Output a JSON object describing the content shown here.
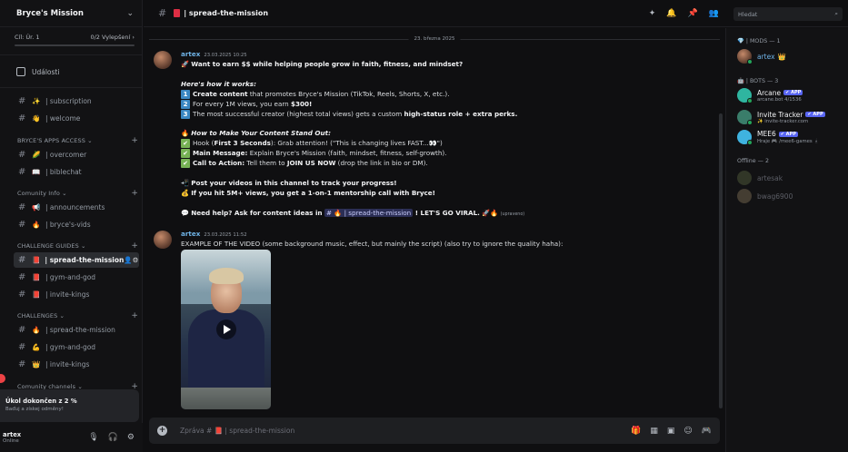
{
  "server": {
    "name": "Bryce's Mission"
  },
  "goal": {
    "label": "Cíl: Úr. 1",
    "progress_text": "0/2 Vylepšení",
    "progress": 0
  },
  "sidebar": {
    "events_label": "Události",
    "top_channels": [
      {
        "emoji": "✨",
        "name": "| subscription"
      },
      {
        "emoji": "👋",
        "name": "| welcome"
      }
    ],
    "categories": [
      {
        "title": "BRYCE'S APPS ACCESS",
        "channels": [
          {
            "emoji": "🌽",
            "name": "| overcomer"
          },
          {
            "emoji": "📖",
            "name": "| biblechat"
          }
        ]
      },
      {
        "title": "Comunity Info",
        "channels": [
          {
            "emoji": "📢",
            "name": "| announcements"
          },
          {
            "emoji": "🔥",
            "name": "| bryce's-vids"
          }
        ]
      },
      {
        "title": "CHALLENGE GUIDES",
        "channels": [
          {
            "emoji": "📕",
            "name": "| spread-the-mission",
            "active": true
          },
          {
            "emoji": "📕",
            "name": "| gym-and-god"
          },
          {
            "emoji": "📕",
            "name": "| invite-kings"
          }
        ]
      },
      {
        "title": "CHALLENGES",
        "channels": [
          {
            "emoji": "🔥",
            "name": "| spread-the-mission"
          },
          {
            "emoji": "💪",
            "name": "| gym-and-god"
          },
          {
            "emoji": "👑",
            "name": "| invite-kings"
          }
        ]
      },
      {
        "title": "Comunity channels",
        "channels": []
      }
    ],
    "task_popup": {
      "title": "Úkol dokončen z 2 %",
      "subtitle": "Baďuj a získej odměny!"
    },
    "user": {
      "name": "artex",
      "status": "Online"
    }
  },
  "header": {
    "channel": "| spread-the-mission",
    "search_placeholder": "Hledat"
  },
  "messages": {
    "date": "23. března 2025",
    "m1": {
      "author": "artex",
      "timestamp": "23.03.2025 10:25",
      "l1": "Want to earn $$ while helping people grow in faith, fitness, and mindset?",
      "l2": "Here's how it works:",
      "l3a": "Create content",
      "l3b": " that promotes Bryce's Mission (TikTok, Reels, Shorts, X, etc.).",
      "l4a": "For every 1M views, you earn ",
      "l4b": "$300!",
      "l5a": "The most successful creator (highest total views) gets a custom ",
      "l5b": "high-status role + extra perks.",
      "l6": "How to Make Your Content Stand Out:",
      "l7a": "Hook (",
      "l7b": "First 3 Seconds",
      "l7c": "): Grab attention! (\"This is changing lives FAST...👀\")",
      "l8a": "Main Message:",
      "l8b": " Explain Bryce's Mission (faith, mindset, fitness, self-growth).",
      "l9a": "Call to Action:",
      "l9b": " Tell them to ",
      "l9c": "JOIN US NOW",
      "l9d": " (drop the link in bio or DM).",
      "l10": "Post your videos in this channel to track your progress!",
      "l11": "If you hit 5M+ views, you get a 1-on-1 mentorship call with Bryce!",
      "l12a": "Need help? Ask for content ideas in ",
      "l12m": "# 🔥 | spread-the-mission",
      "l12b": " ! LET'S GO VIRAL. 🚀🔥",
      "l12e": "(upraveno)"
    },
    "m2": {
      "author": "artex",
      "timestamp": "23.03.2025 11:52",
      "text": "EXAMPLE OF THE VIDEO (some background music, effect, but mainly the script) (also try to ignore the quality haha):"
    }
  },
  "composer": {
    "placeholder": "Zpráva # 📕 | spread-the-mission"
  },
  "members": {
    "mods_title": "| MODS — 1",
    "mod": {
      "name": "artex",
      "badge": "👑"
    },
    "bots_title": "| BOTS — 3",
    "bots": [
      {
        "name": "Arcane",
        "tag": "✔ APP",
        "sub": "arcane.bot 4/1536"
      },
      {
        "name": "Invite Tracker",
        "tag": "✔ APP",
        "sub": "✨ invite-tracker.com"
      },
      {
        "name": "MEE6",
        "tag": "✔ APP",
        "sub": "Hraje 🎮 /mee6-games 🛓"
      }
    ],
    "offline_title": "Offline — 2",
    "offline": [
      {
        "name": "artesak"
      },
      {
        "name": "bwag6900"
      }
    ]
  },
  "colors": {
    "accent": "#5865f2",
    "link": "#6fb4e8",
    "online": "#23a55a",
    "background": "#0f0f11"
  }
}
